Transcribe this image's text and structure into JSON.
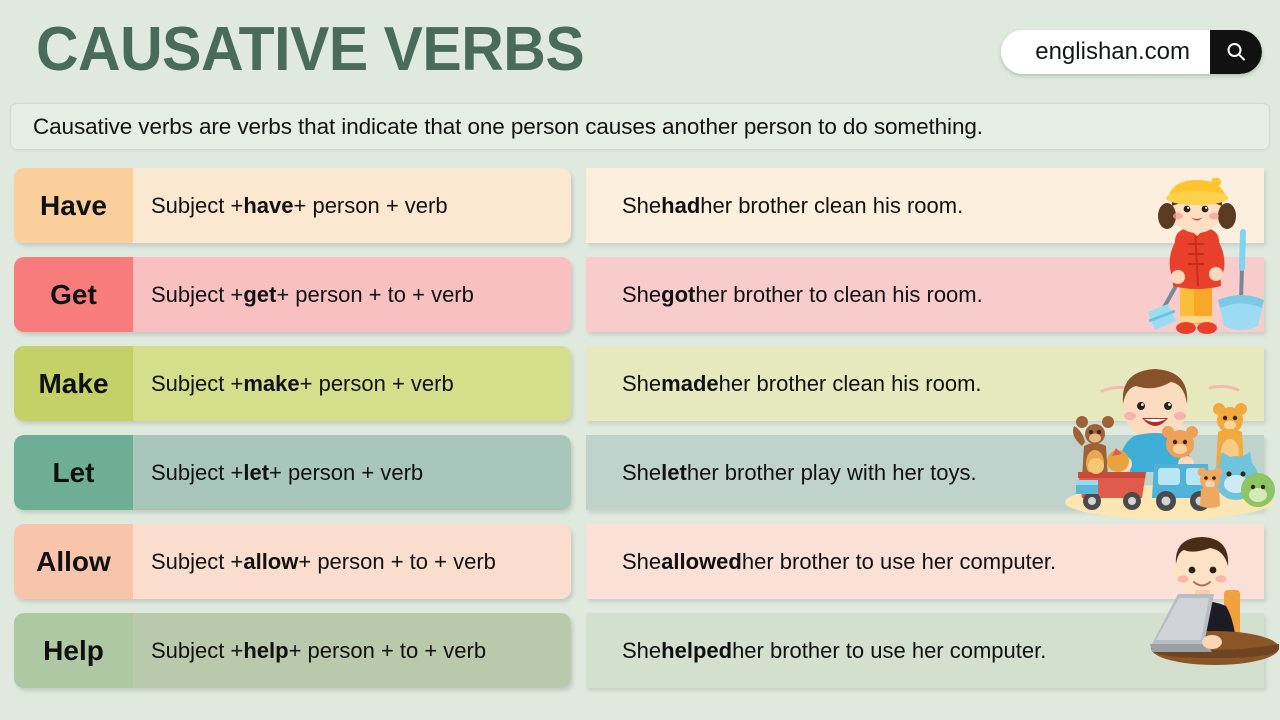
{
  "header": {
    "title": "CAUSATIVE VERBS",
    "search": {
      "value": "englishan.com",
      "icon": "search-icon"
    }
  },
  "definition": {
    "text": "Causative verbs are verbs that indicate that one person causes another person to do something."
  },
  "rows": [
    {
      "verb": "Have",
      "formula_prefix": "Subject + ",
      "formula_keyword": "have",
      "formula_suffix": " + person + verb",
      "example_prefix": "She ",
      "example_keyword": "had",
      "example_suffix": " her brother clean his room.",
      "chip_color": "#fbcf9b",
      "body_color": "#fce8d0",
      "right_color": "#fcefdd"
    },
    {
      "verb": "Get",
      "formula_prefix": "Subject + ",
      "formula_keyword": "get",
      "formula_suffix": " + person + to + verb",
      "example_prefix": "She ",
      "example_keyword": "got",
      "example_suffix": " her brother to clean his room.",
      "chip_color": "#f97c7c",
      "body_color": "#f8c0c0",
      "right_color": "#f9cccc"
    },
    {
      "verb": "Make",
      "formula_prefix": "Subject + ",
      "formula_keyword": "make",
      "formula_suffix": " + person + verb",
      "example_prefix": "She ",
      "example_keyword": "made",
      "example_suffix": " her brother clean his room.",
      "chip_color": "#c3d167",
      "body_color": "#d5de8a",
      "right_color": "#e5e9bd"
    },
    {
      "verb": "Let",
      "formula_prefix": "Subject + ",
      "formula_keyword": "let",
      "formula_suffix": " + person + verb",
      "example_prefix": "She ",
      "example_keyword": "let",
      "example_suffix": " her brother play with her toys.",
      "chip_color": "#6fae96",
      "body_color": "#a9c6bc",
      "right_color": "#bfd3cc"
    },
    {
      "verb": "Allow",
      "formula_prefix": "Subject + ",
      "formula_keyword": "allow",
      "formula_suffix": " + person + to + verb",
      "example_prefix": "She ",
      "example_keyword": "allowed",
      "example_suffix": " her brother to use her computer.",
      "chip_color": "#f8c4ac",
      "body_color": "#fbddcd",
      "right_color": "#fbe0d8"
    },
    {
      "verb": "Help",
      "formula_prefix": "Subject + ",
      "formula_keyword": "help",
      "formula_suffix": " + person + to + verb",
      "example_prefix": "She ",
      "example_keyword": "helped",
      "example_suffix": " her brother to use her computer.",
      "chip_color": "#adc8a3",
      "body_color": "#b8c9ac",
      "right_color": "#d3e0cd"
    }
  ],
  "illustrations": [
    {
      "name": "girl-cleaning-with-broom-illustration"
    },
    {
      "name": "boy-with-toys-illustration"
    },
    {
      "name": "man-using-laptop-illustration"
    }
  ],
  "colors": {
    "background": "#dfe9de",
    "title": "#4a6b59",
    "definition_box": "#e5eee4"
  }
}
